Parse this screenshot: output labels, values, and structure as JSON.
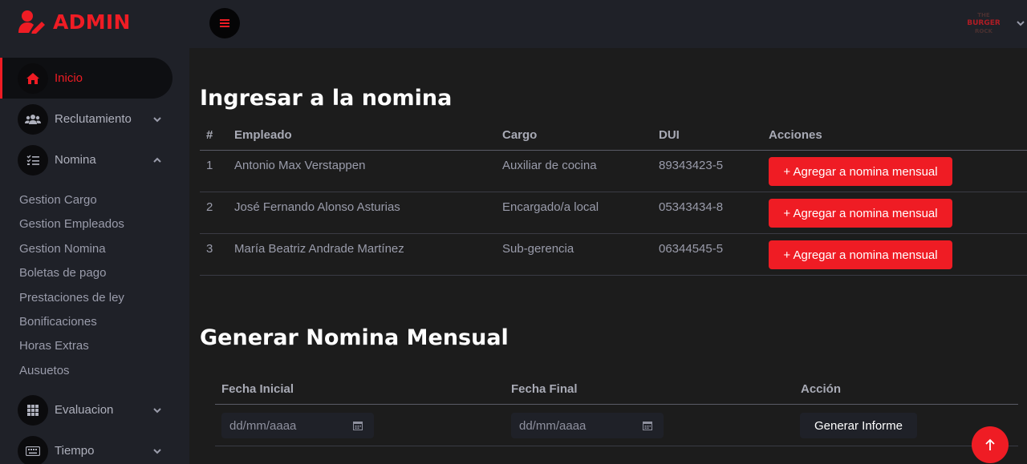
{
  "brand": {
    "title": "ADMIN",
    "icon": "user-edit-icon"
  },
  "sidebar": {
    "items": [
      {
        "label": "Inicio",
        "icon": "home-icon",
        "active": true
      },
      {
        "label": "Reclutamiento",
        "icon": "users-icon",
        "chevron": "down"
      },
      {
        "label": "Nomina",
        "icon": "list-check-icon",
        "chevron": "up"
      },
      {
        "label": "Evaluacion",
        "icon": "grid-icon",
        "chevron": "down"
      },
      {
        "label": "Tiempo",
        "icon": "keyboard-icon",
        "chevron": "down"
      }
    ],
    "nomina_sub": [
      "Gestion Cargo",
      "Gestion Empleados",
      "Gestion Nomina",
      "Boletas de pago",
      "Prestaciones de ley",
      "Bonificaciones",
      "Horas Extras",
      "Ausuetos"
    ]
  },
  "topbar": {
    "menu_icon": "hamburger-icon",
    "logo_text": [
      "THE",
      "BURGER",
      "ROCK"
    ]
  },
  "section1": {
    "title": "Ingresar a la nomina",
    "headers": [
      "#",
      "Empleado",
      "Cargo",
      "DUI",
      "Acciones"
    ],
    "rows": [
      {
        "num": "1",
        "empleado": "Antonio Max Verstappen",
        "cargo": "Auxiliar de cocina",
        "dui": "89343423-5",
        "action": "+ Agregar a nomina mensual"
      },
      {
        "num": "2",
        "empleado": "José Fernando Alonso Asturias",
        "cargo": "Encargado/a local",
        "dui": "05343434-8",
        "action": "+ Agregar a nomina mensual"
      },
      {
        "num": "3",
        "empleado": "María Beatriz Andrade Martínez",
        "cargo": "Sub-gerencia",
        "dui": "06344545-5",
        "action": "+ Agregar a nomina mensual"
      }
    ]
  },
  "section2": {
    "title": "Generar Nomina Mensual",
    "headers": [
      "Fecha Inicial",
      "Fecha Final",
      "Acción"
    ],
    "fecha_inicial_placeholder": "dd/mm/aaaa",
    "fecha_final_placeholder": "dd/mm/aaaa",
    "button": "Generar Informe"
  },
  "colors": {
    "accent": "#ef1c24",
    "sidebar_bg": "#1f2128",
    "main_bg": "#1c1c1c"
  }
}
